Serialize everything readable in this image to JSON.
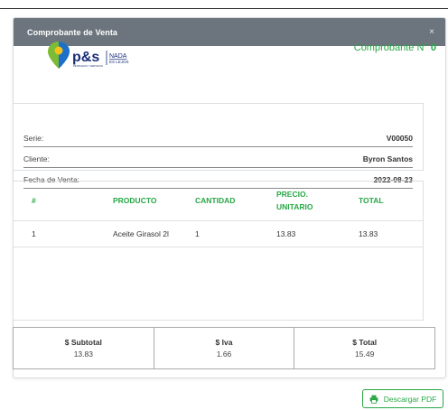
{
  "modal": {
    "title": "Comprobante de Venta",
    "close_glyph": "×"
  },
  "brand": {
    "name": "p&s",
    "slogan_line1": "NADA",
    "slogan_line2": "ES LEJOS",
    "subtext": "PETROLEOS Y SERVICIOS",
    "colors": {
      "brand_navy": "#1a2e7a",
      "pin_green": "#7cbb35",
      "pin_blue": "#1e6fc9",
      "pin_yellow": "#f4c21b"
    }
  },
  "comprobante": {
    "label": "Comprobante N°",
    "number": "0"
  },
  "info": [
    {
      "label": "Serie:",
      "value": "V00050"
    },
    {
      "label": "Cliente:",
      "value": "Byron Santos"
    },
    {
      "label": "Fecha de Venta:",
      "value": "2022-08-23"
    }
  ],
  "table": {
    "headers": {
      "num": "#",
      "product": "PRODUCTO",
      "quantity": "CANTIDAD",
      "price_line1": "PRECIO.",
      "price_line2": "UNITARIO",
      "total": "TOTAL"
    },
    "rows": [
      {
        "num": "1",
        "product": "Aceite Girasol 2l",
        "quantity": "1",
        "price": "13.83",
        "total": "13.83"
      }
    ]
  },
  "totals": {
    "subtotal_label": "$ Subtotal",
    "subtotal_value": "13.83",
    "iva_label": "$ Iva",
    "iva_value": "1.66",
    "total_label": "$ Total",
    "total_value": "15.49"
  },
  "pdf_button": {
    "label": "Descargar PDF",
    "icon": "printer-icon"
  },
  "colors": {
    "accent_green": "#28a745",
    "header_gray": "#6c757d"
  }
}
